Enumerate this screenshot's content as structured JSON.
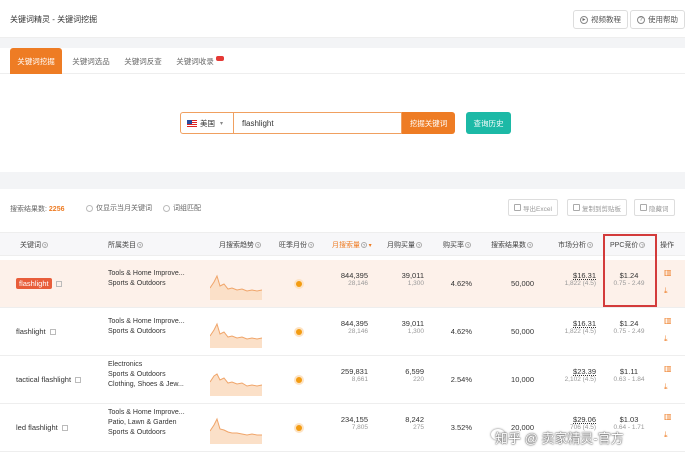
{
  "header": {
    "title": "关键词精灵 - 关键词挖掘",
    "video_btn": "视频教程",
    "help_btn": "使用帮助"
  },
  "tabs": [
    {
      "label": "关键词挖掘",
      "active": true
    },
    {
      "label": "关键词选品",
      "active": false
    },
    {
      "label": "关键词反查",
      "active": false
    },
    {
      "label": "关键词收录",
      "active": false
    }
  ],
  "search": {
    "country": "美国",
    "query": "flashlight",
    "dig_btn": "挖掘关键词",
    "history_btn": "查询历史"
  },
  "results": {
    "count_label": "搜索结果数:",
    "count": "2256",
    "opt_current_month": "仅显示当月关键词",
    "opt_phrase_match": "词组匹配",
    "export_btn": "导出Excel",
    "copy_btn": "复制到剪贴板",
    "hide_btn": "隐藏词"
  },
  "columns": [
    "关键词",
    "所属类目",
    "月搜索趋势",
    "旺季月份",
    "月搜索量",
    "月购买量",
    "购买率",
    "搜索结果数",
    "市场分析",
    "PPC竞价",
    "操作"
  ],
  "rows": [
    {
      "keyword": "flashlight",
      "highlight": true,
      "categories": [
        "Tools & Home Improve...",
        "Sports & Outdoors",
        ""
      ],
      "search_vol": "844,395",
      "search_vol_sub": "28,146",
      "purchase": "39,011",
      "purchase_sub": "1,300",
      "rate": "4.62%",
      "results": "50,000",
      "market": "$16.31",
      "market_sub": "1,822 (4.5)",
      "ppc": "$1.24",
      "ppc_range": "0.75 - 2.49"
    },
    {
      "keyword": "flashlight",
      "highlight": false,
      "categories": [
        "Tools & Home Improve...",
        "Sports & Outdoors",
        ""
      ],
      "search_vol": "844,395",
      "search_vol_sub": "28,146",
      "purchase": "39,011",
      "purchase_sub": "1,300",
      "rate": "4.62%",
      "results": "50,000",
      "market": "$16.31",
      "market_sub": "1,822 (4.5)",
      "ppc": "$1.24",
      "ppc_range": "0.75 - 2.49"
    },
    {
      "keyword": "tactical flashlight",
      "highlight": false,
      "categories": [
        "Electronics",
        "Sports & Outdoors",
        "Clothing, Shoes & Jew..."
      ],
      "search_vol": "259,831",
      "search_vol_sub": "8,661",
      "purchase": "6,599",
      "purchase_sub": "220",
      "rate": "2.54%",
      "results": "10,000",
      "market": "$23.39",
      "market_sub": "2,102 (4.5)",
      "ppc": "$1.11",
      "ppc_range": "0.63 - 1.84"
    },
    {
      "keyword": "led flashlight",
      "highlight": false,
      "categories": [
        "Tools & Home Improve...",
        "Patio, Lawn & Garden",
        "Sports & Outdoors"
      ],
      "search_vol": "234,155",
      "search_vol_sub": "7,805",
      "purchase": "8,242",
      "purchase_sub": "275",
      "rate": "3.52%",
      "results": "20,000",
      "market": "$29.06",
      "market_sub": "706 (4.5)",
      "ppc": "$1.03",
      "ppc_range": "0.64 - 1.71"
    }
  ],
  "watermark": "知乎 @ 卖家精灵-官方",
  "colors": {
    "accent": "#ee7c24",
    "teal": "#1cb9a6",
    "highlight_box": "#d33b3b"
  }
}
